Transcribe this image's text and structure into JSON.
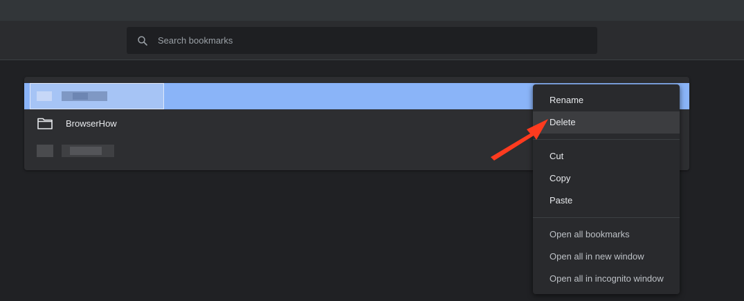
{
  "search": {
    "placeholder": "Search bookmarks",
    "icon": "search-icon"
  },
  "bookmarks": {
    "items": [
      {
        "label": "",
        "redacted": true,
        "selected": true
      },
      {
        "label": "BrowserHow",
        "icon": "folder-icon"
      },
      {
        "label": "",
        "redacted": true
      }
    ]
  },
  "context_menu": {
    "rename": "Rename",
    "delete": "Delete",
    "cut": "Cut",
    "copy": "Copy",
    "paste": "Paste",
    "open_all": "Open all bookmarks",
    "open_new_window": "Open all in new window",
    "open_incognito": "Open all in incognito window"
  },
  "colors": {
    "selection": "#8ab4f8",
    "annotation_arrow": "#ff3b1f"
  }
}
